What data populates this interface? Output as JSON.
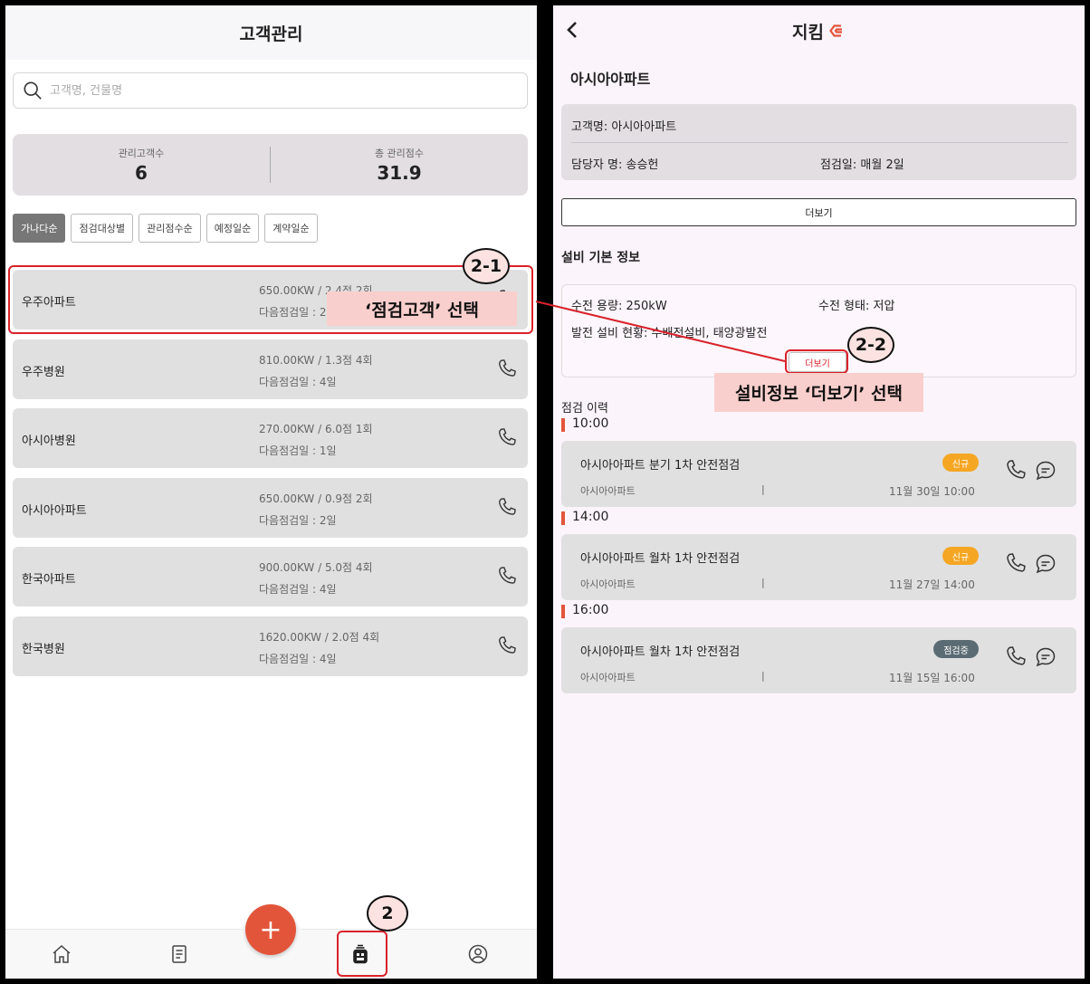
{
  "left": {
    "title": "고객관리",
    "search_placeholder": "고객명, 건물명",
    "stats": [
      {
        "label": "관리고객수",
        "value": "6"
      },
      {
        "label": "총 관리점수",
        "value": "31.9"
      }
    ],
    "sorts": [
      "가나다순",
      "점검대상별",
      "관리점수순",
      "예정일순",
      "계약일순"
    ],
    "customers": [
      {
        "name": "우주아파트",
        "info1": "650.00KW / 2.4점 2회",
        "info2": "다음점검일 : 2일"
      },
      {
        "name": "우주병원",
        "info1": "810.00KW / 1.3점 4회",
        "info2": "다음점검일 : 4일"
      },
      {
        "name": "아시아병원",
        "info1": "270.00KW / 6.0점 1회",
        "info2": "다음점검일 : 1일"
      },
      {
        "name": "아시아아파트",
        "info1": "650.00KW / 0.9점 2회",
        "info2": "다음점검일 : 2일"
      },
      {
        "name": "한국아파트",
        "info1": "900.00KW / 5.0점 4회",
        "info2": "다음점검일 : 4일"
      },
      {
        "name": "한국병원",
        "info1": "1620.00KW / 2.0점 4회",
        "info2": "다음점검일 : 4일"
      }
    ],
    "fab_label": "+"
  },
  "annotations": {
    "badge_2_1": "2-1",
    "callout_2_1": "‘점검고객’ 선택",
    "badge_2_2": "2-2",
    "callout_2_2": "설비정보 ‘더보기’ 선택",
    "badge_2": "2",
    "color": "#d9222a"
  },
  "right": {
    "title": "지킴",
    "customer_name": "아시아아파트",
    "info": {
      "customer": "고객명: 아시아아파트",
      "manager": "담당자 명: 송승헌",
      "inspection_day": "점검일: 매월 2일"
    },
    "more_label": "더보기",
    "equip_title": "설비 기본 정보",
    "equip": {
      "capacity": "수전 용량: 250kW",
      "type": "수전 형태: 저압",
      "gen": "발전 설비 현황: 수배전설비, 태양광발전",
      "more_label": "더보기"
    },
    "history_title": "점검 이력",
    "history": [
      {
        "time": "10:00",
        "title": "아시아아파트 분기 1차 안전점검",
        "sub": "아시아아파트",
        "sep": "|",
        "date": "11월 30일 10:00",
        "status": "신규"
      },
      {
        "time": "14:00",
        "title": "아시아아파트 월차 1차 안전점검",
        "sub": "아시아아파트",
        "sep": "|",
        "date": "11월 27일 14:00",
        "status": "신규"
      },
      {
        "time": "16:00",
        "title": "아시아아파트 월차 1차 안전점검",
        "sub": "아시아아파트",
        "sep": "|",
        "date": "11월 15일 16:00",
        "status": "점검중"
      }
    ]
  },
  "colors": {
    "accent": "#e3553a",
    "new_badge": "#f5a623",
    "progress_badge": "#5b6b73"
  }
}
